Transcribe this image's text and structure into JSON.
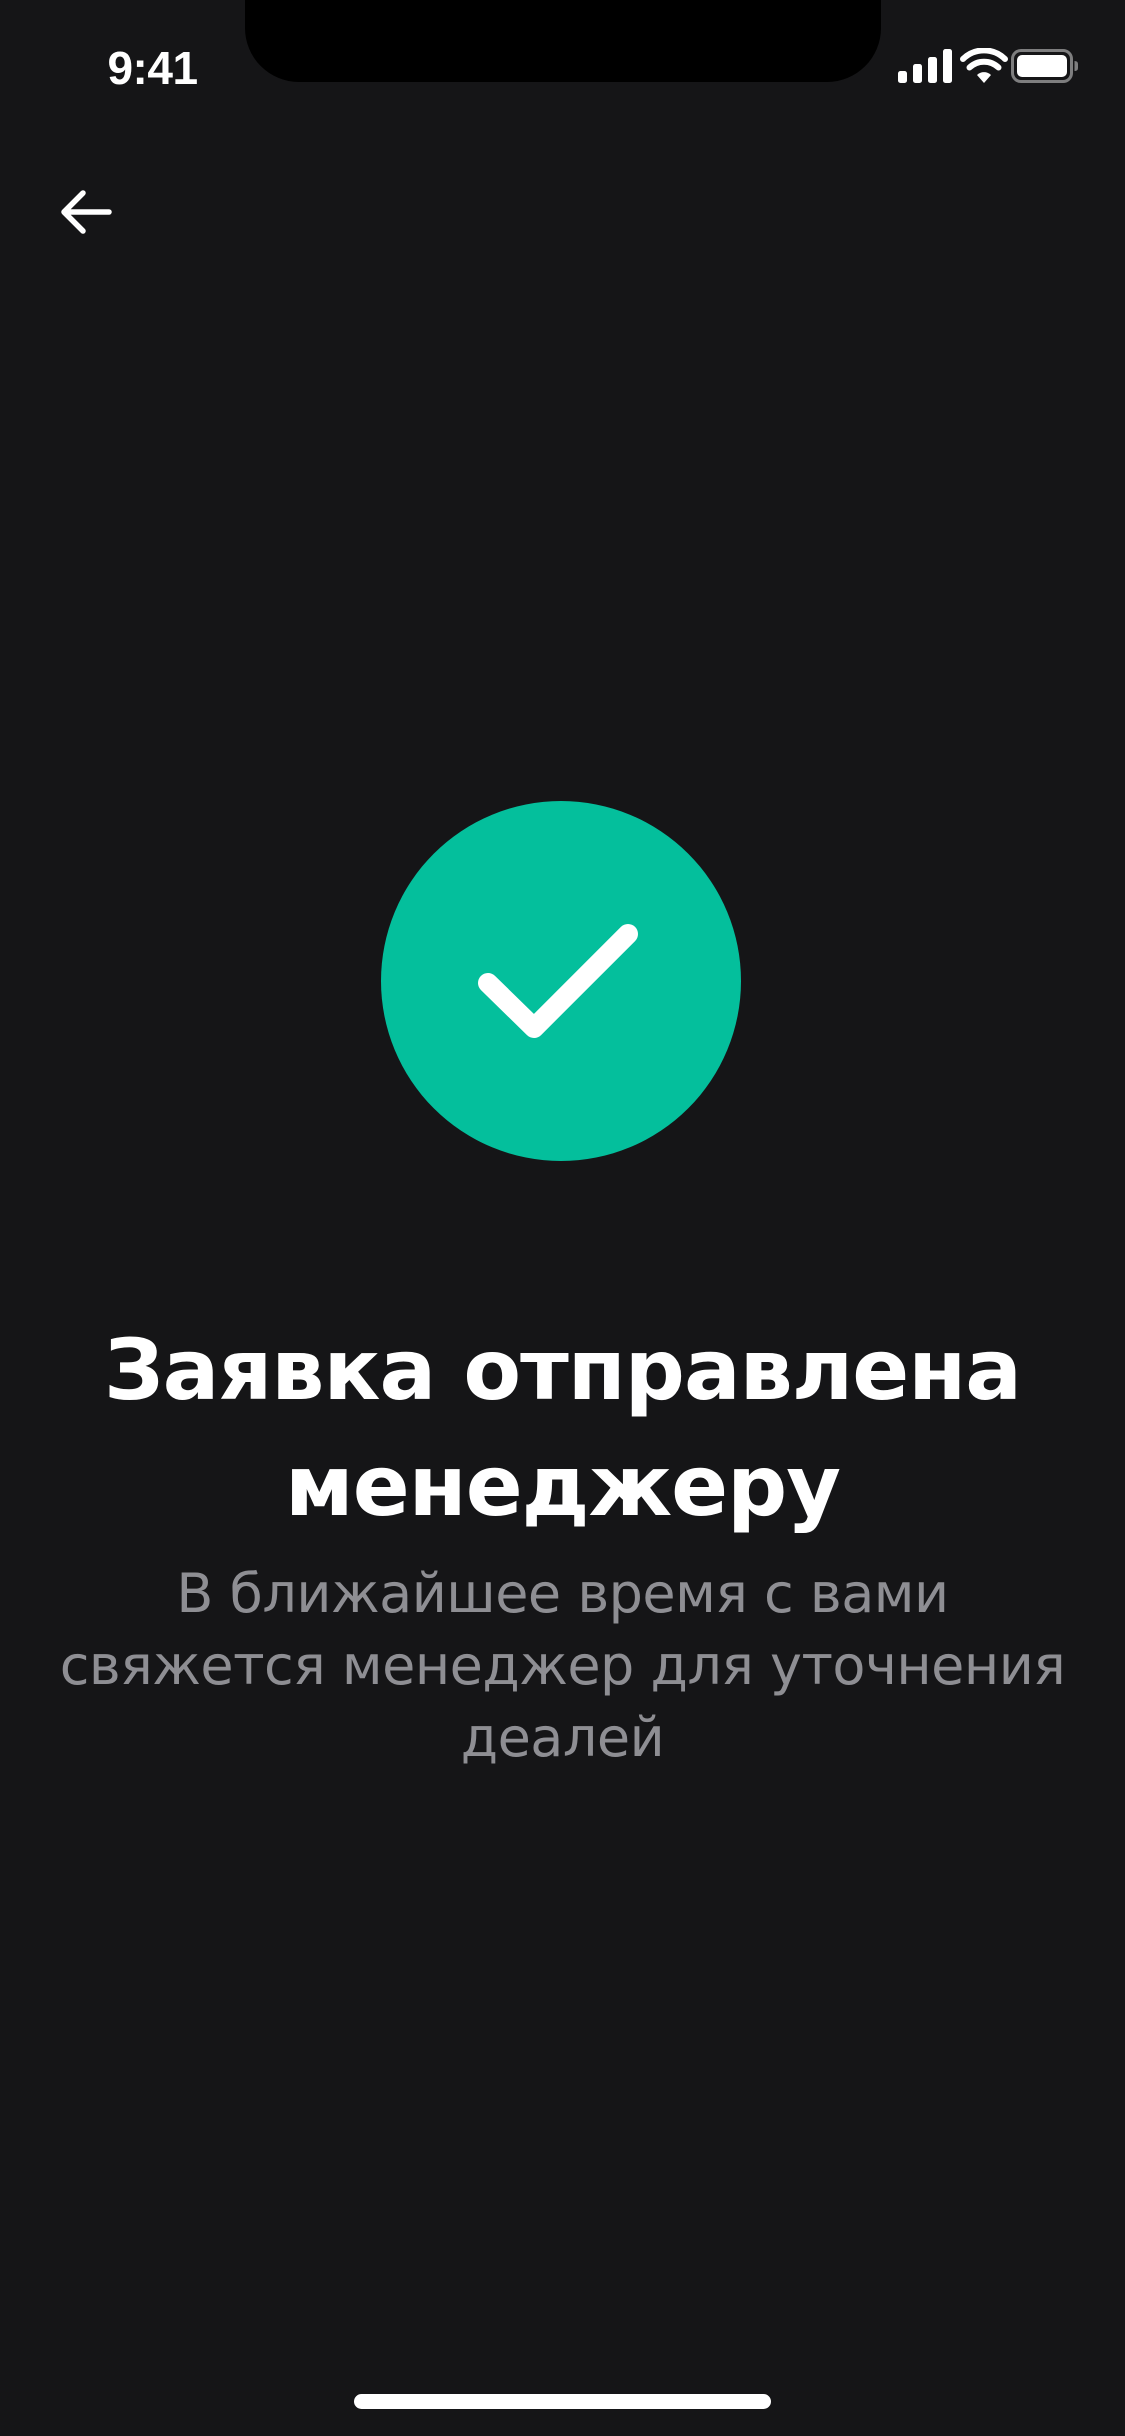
{
  "status_bar": {
    "time": "9:41"
  },
  "navigation": {
    "back_icon": "arrow-left-icon"
  },
  "success": {
    "icon": "checkmark-icon",
    "accent_color": "#04bf9c",
    "title": "Заявка отправлена менеджеру",
    "subtitle": "В ближайшее время с вами свяжется менеджер для уточнения деалей"
  },
  "colors": {
    "background": "#151517",
    "title": "#ffffff",
    "subtitle": "#8e8e93"
  }
}
